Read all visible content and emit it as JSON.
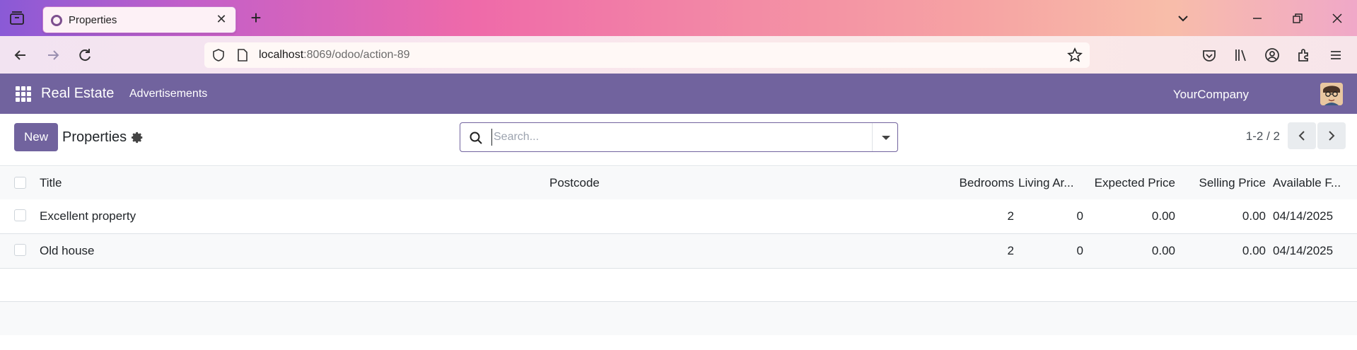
{
  "browser": {
    "tab": {
      "title": "Properties"
    },
    "url": {
      "host": "localhost",
      "path": ":8069/odoo/action-89"
    }
  },
  "app": {
    "brand": "Real Estate",
    "menu": [
      "Advertisements"
    ],
    "company": "YourCompany",
    "primary_color": "#71639e"
  },
  "control_panel": {
    "new_label": "New",
    "title": "Properties",
    "search_placeholder": "Search...",
    "pager": "1-2 / 2"
  },
  "list": {
    "columns": {
      "title": "Title",
      "postcode": "Postcode",
      "bedrooms": "Bedrooms",
      "living_area": "Living Ar...",
      "expected_price": "Expected Price",
      "selling_price": "Selling Price",
      "available_from": "Available F..."
    },
    "rows": [
      {
        "title": "Excellent property",
        "postcode": "",
        "bedrooms": "2",
        "living_area": "0",
        "expected_price": "0.00",
        "selling_price": "0.00",
        "available_from": "04/14/2025"
      },
      {
        "title": "Old house",
        "postcode": "",
        "bedrooms": "2",
        "living_area": "0",
        "expected_price": "0.00",
        "selling_price": "0.00",
        "available_from": "04/14/2025"
      }
    ]
  }
}
